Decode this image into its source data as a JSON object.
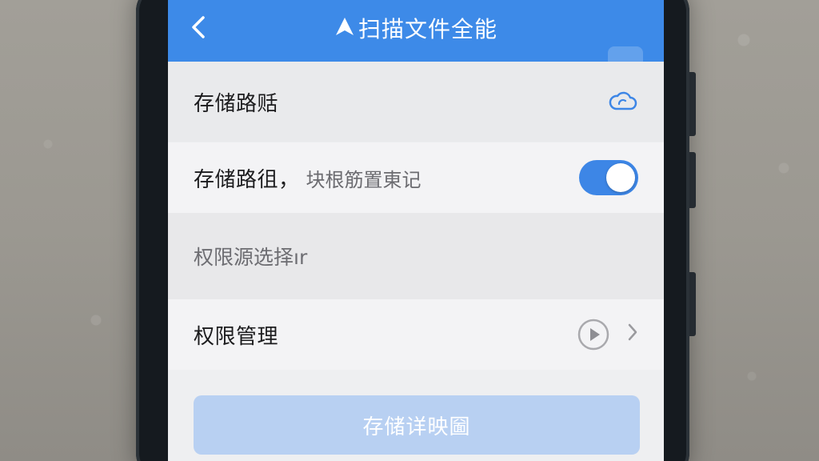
{
  "header": {
    "back_label": "‹",
    "title": "扫描文件全能"
  },
  "rows": {
    "storage_path": {
      "label": "存储路䞌",
      "icon": "cloud-icon"
    },
    "storage_toggle": {
      "label": "存储路徂，",
      "sublabel": "块根筋置東记",
      "toggle_on": true
    },
    "permission_section": {
      "label": "权限源选择ır"
    },
    "permission_manage": {
      "label": "权限管理",
      "icon": "play-circle-icon"
    }
  },
  "primary_button": {
    "label": "存储详映圙"
  },
  "colors": {
    "accent": "#3d8ae8",
    "button_disabled": "#b8d0f2"
  }
}
